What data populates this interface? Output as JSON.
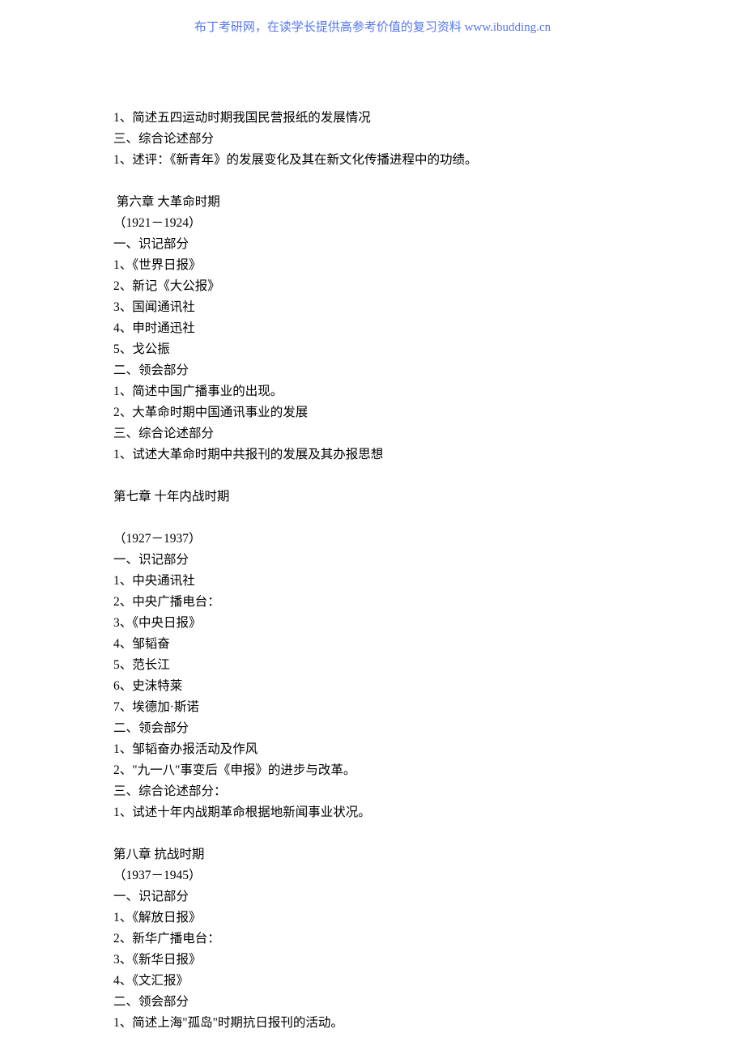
{
  "header": {
    "text_prefix": "布丁考研网，在读学长提供高参考价值的复习资料   ",
    "link_text": "www.ibudding.cn"
  },
  "lines": [
    "1、简述五四运动时期我国民营报纸的发展情况",
    "三、综合论述部分",
    "1、述评：《新青年》的发展变化及其在新文化传播进程中的功绩。",
    "",
    " 第六章 大革命时期",
    "（1921－1924）",
    "一、识记部分",
    "1、《世界日报》",
    "2、新记《大公报》",
    "3、国闻通讯社",
    "4、申时通迅社",
    "5、戈公振",
    "二、领会部分",
    "1、简述中国广播事业的出现。",
    "2、大革命时期中国通讯事业的发展",
    "三、综合论述部分",
    "1、试述大革命时期中共报刊的发展及其办报思想",
    "",
    "第七章 十年内战时期",
    "",
    "（1927－1937）",
    "一、识记部分",
    "1、中央通讯社",
    "2、中央广播电台：",
    "3、《中央日报》",
    "4、邹韬奋",
    "5、范长江",
    "6、史沫特莱",
    "7、埃德加·斯诺",
    "二、领会部分",
    "1、邹韬奋办报活动及作风",
    "2、\"九一八\"事变后《申报》的进步与改革。",
    "三、综合论述部分：",
    "1、试述十年内战期革命根据地新闻事业状况。",
    "",
    "第八章 抗战时期",
    "（1937－1945）",
    "一、识记部分",
    "1、《解放日报》",
    "2、新华广播电台：",
    "3、《新华日报》",
    "4、《文汇报》",
    "二、领会部分",
    "1、简述上海\"孤岛\"时期抗日报刊的活动。"
  ]
}
